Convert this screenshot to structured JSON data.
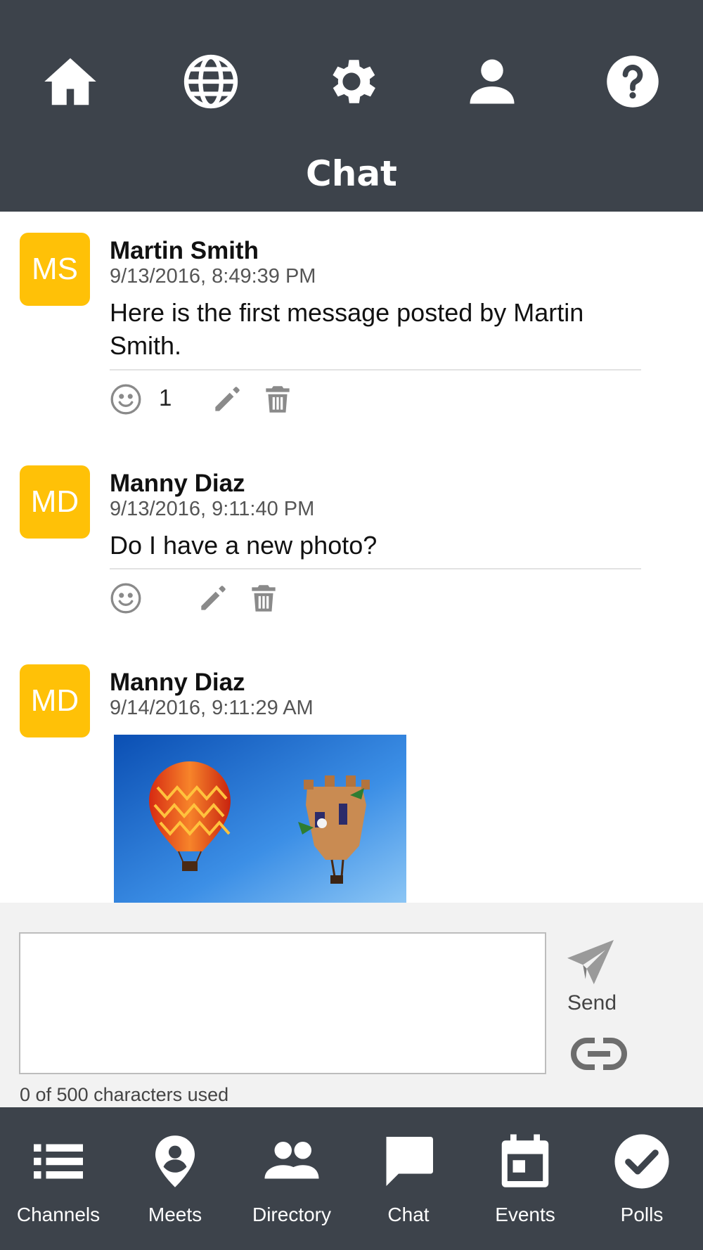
{
  "header": {
    "title": "Chat",
    "icons": [
      "home-icon",
      "globe-icon",
      "gear-icon",
      "user-icon",
      "help-icon"
    ]
  },
  "messages": [
    {
      "initials": "MS",
      "author": "Martin Smith",
      "timestamp": "9/13/2016, 8:49:39 PM",
      "text": "Here is the first message posted by Martin Smith.",
      "reaction_count": "1"
    },
    {
      "initials": "MD",
      "author": "Manny Diaz",
      "timestamp": "9/13/2016, 9:11:40 PM",
      "text": "Do I have a new photo?",
      "reaction_count": ""
    },
    {
      "initials": "MD",
      "author": "Manny Diaz",
      "timestamp": "9/14/2016, 9:11:29 AM",
      "text": "",
      "has_photo": true
    }
  ],
  "composer": {
    "value": "",
    "placeholder": "",
    "send_label": "Send",
    "char_count_text": "0 of 500 characters used"
  },
  "nav": {
    "items": [
      {
        "label": "Channels",
        "icon": "list-icon"
      },
      {
        "label": "Meets",
        "icon": "location-pin-icon"
      },
      {
        "label": "Directory",
        "icon": "people-icon"
      },
      {
        "label": "Chat",
        "icon": "chat-bubble-icon"
      },
      {
        "label": "Events",
        "icon": "calendar-icon"
      },
      {
        "label": "Polls",
        "icon": "check-circle-icon"
      }
    ]
  },
  "colors": {
    "bar": "#3d434b",
    "avatar": "#ffc107",
    "composer_bg": "#f2f2f2",
    "action_icon": "#8a8a8a"
  }
}
